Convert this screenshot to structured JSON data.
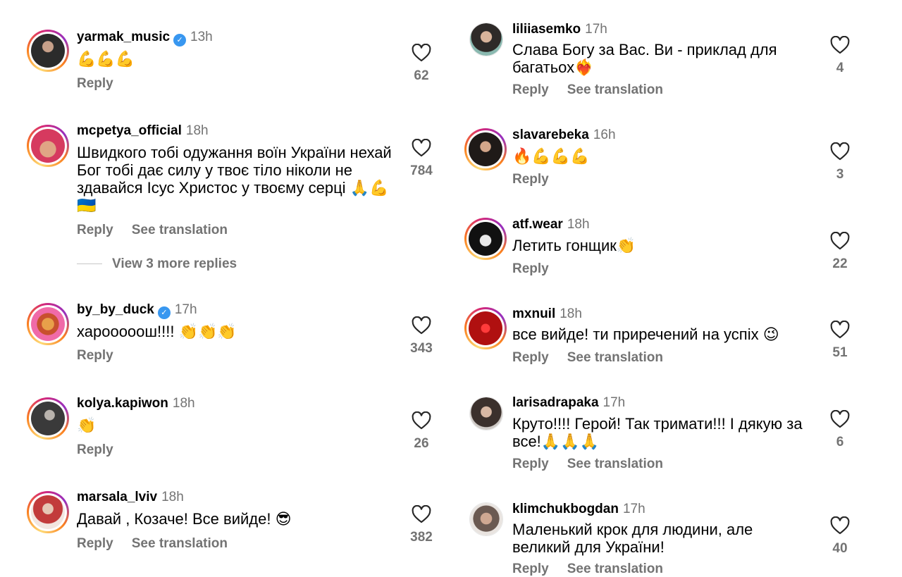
{
  "left_comments": [
    {
      "username": "yarmak_music",
      "verified": true,
      "time": "13h",
      "text": "💪💪💪",
      "reply": "Reply",
      "translate": "",
      "likes": "62"
    },
    {
      "username": "mcpetya_official",
      "verified": false,
      "time": "18h",
      "text": "Швидкого тобі одужання воїн України нехай Бог тобі дає силу у твоє тіло ніколи не здавайся Ісус Христос у твоєму серці 🙏💪🇺🇦",
      "reply": "Reply",
      "translate": "See translation",
      "likes": "784",
      "more_replies": "View 3 more replies"
    },
    {
      "username": "by_by_duck",
      "verified": true,
      "time": "17h",
      "text": "харооооош!!!! 👏👏👏",
      "reply": "Reply",
      "translate": "",
      "likes": "343"
    },
    {
      "username": "kolya.kapiwon",
      "verified": false,
      "time": "18h",
      "text": "👏",
      "reply": "Reply",
      "translate": "",
      "likes": "26"
    },
    {
      "username": "marsala_lviv",
      "verified": false,
      "time": "18h",
      "text": "Давай , Козаче! Все вийде! 😎",
      "reply": "Reply",
      "translate": "See translation",
      "likes": "382"
    }
  ],
  "right_comments": [
    {
      "username": "liliiasemko",
      "verified": false,
      "time": "17h",
      "text": "Слава Богу за Вас. Ви - приклад для багатьох❤️‍🔥",
      "reply": "Reply",
      "translate": "See translation",
      "likes": "4"
    },
    {
      "username": "slavarebeka",
      "verified": false,
      "time": "16h",
      "text": "🔥💪💪💪",
      "reply": "Reply",
      "translate": "",
      "likes": "3"
    },
    {
      "username": "atf.wear",
      "verified": false,
      "time": "18h",
      "text": "Летить гонщик👏",
      "reply": "Reply",
      "translate": "",
      "likes": "22"
    },
    {
      "username": "mxnuil",
      "verified": false,
      "time": "18h",
      "text": "все вийде! ти приречений на успіх 😉",
      "reply": "Reply",
      "translate": "See translation",
      "likes": "51"
    },
    {
      "username": "larisadrapaka",
      "verified": false,
      "time": "17h",
      "text": "Круто!!!! Герой! Так тримати!!! І дякую за все!🙏🙏🙏",
      "reply": "Reply",
      "translate": "See translation",
      "likes": "6"
    },
    {
      "username": "klimchukbogdan",
      "verified": false,
      "time": "17h",
      "text": "Маленький крок для людини, але великий для України!",
      "reply": "Reply",
      "translate": "See translation",
      "likes": "40"
    }
  ],
  "icons": {
    "like": "heart-outline-icon",
    "verified": "verified-badge-icon"
  },
  "colors": {
    "secondary_text": "#737373",
    "verified_blue": "#3897f0",
    "story_ring": "#d62976"
  }
}
